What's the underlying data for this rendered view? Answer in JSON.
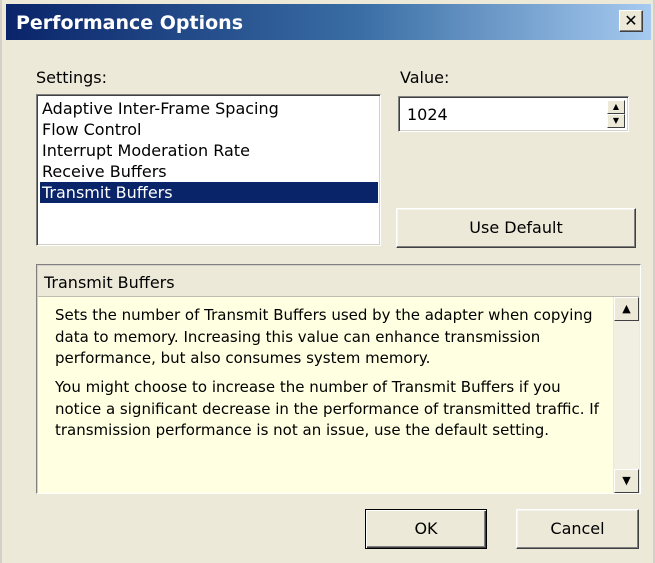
{
  "window": {
    "title": "Performance Options",
    "close_glyph": "✕"
  },
  "settings": {
    "label": "Settings:",
    "items": [
      {
        "label": "Adaptive Inter-Frame Spacing",
        "selected": false
      },
      {
        "label": "Flow Control",
        "selected": false
      },
      {
        "label": "Interrupt Moderation Rate",
        "selected": false
      },
      {
        "label": "Receive Buffers",
        "selected": false
      },
      {
        "label": "Transmit Buffers",
        "selected": true
      }
    ]
  },
  "value": {
    "label": "Value:",
    "current": "1024",
    "spin_up": "▲",
    "spin_down": "▼"
  },
  "use_default_label": "Use Default",
  "description": {
    "header": "Transmit Buffers",
    "paragraphs": [
      "Sets the number of Transmit Buffers used by the adapter when copying data to memory. Increasing this value can enhance transmission performance, but also consumes system memory.",
      "You might choose to increase the number of Transmit Buffers if you notice a significant decrease in the performance of transmitted traffic. If transmission performance is not an issue, use the default setting."
    ],
    "scroll_up": "▲",
    "scroll_down": "▼"
  },
  "buttons": {
    "ok": "OK",
    "cancel": "Cancel"
  },
  "colors": {
    "title_bar": "#0a246a",
    "selection": "#0a246a",
    "description_background": "#ffffe1",
    "dialog_face": "#ece9d8"
  }
}
